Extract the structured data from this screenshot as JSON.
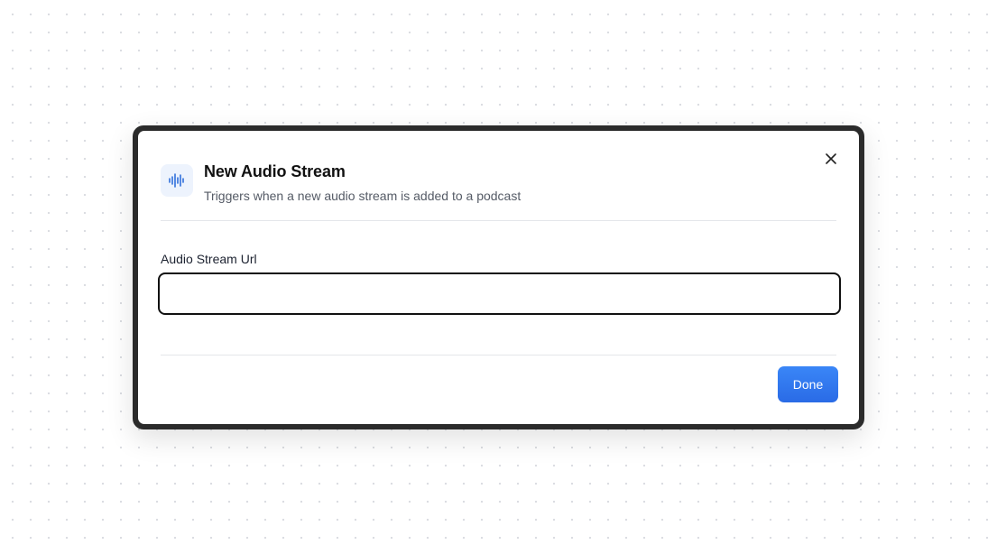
{
  "modal": {
    "title": "New Audio Stream",
    "subtitle": "Triggers when a new audio stream is added to a podcast",
    "header_icon": "audio-waveform-icon",
    "close_icon": "close-icon",
    "field": {
      "label": "Audio Stream Url",
      "value": "",
      "placeholder": ""
    },
    "done_label": "Done"
  },
  "colors": {
    "accent": "#2f77ee",
    "icon_bg": "#edf3fd",
    "frame": "#2b2b2b",
    "text_primary": "#111111",
    "text_secondary": "#555b66"
  }
}
